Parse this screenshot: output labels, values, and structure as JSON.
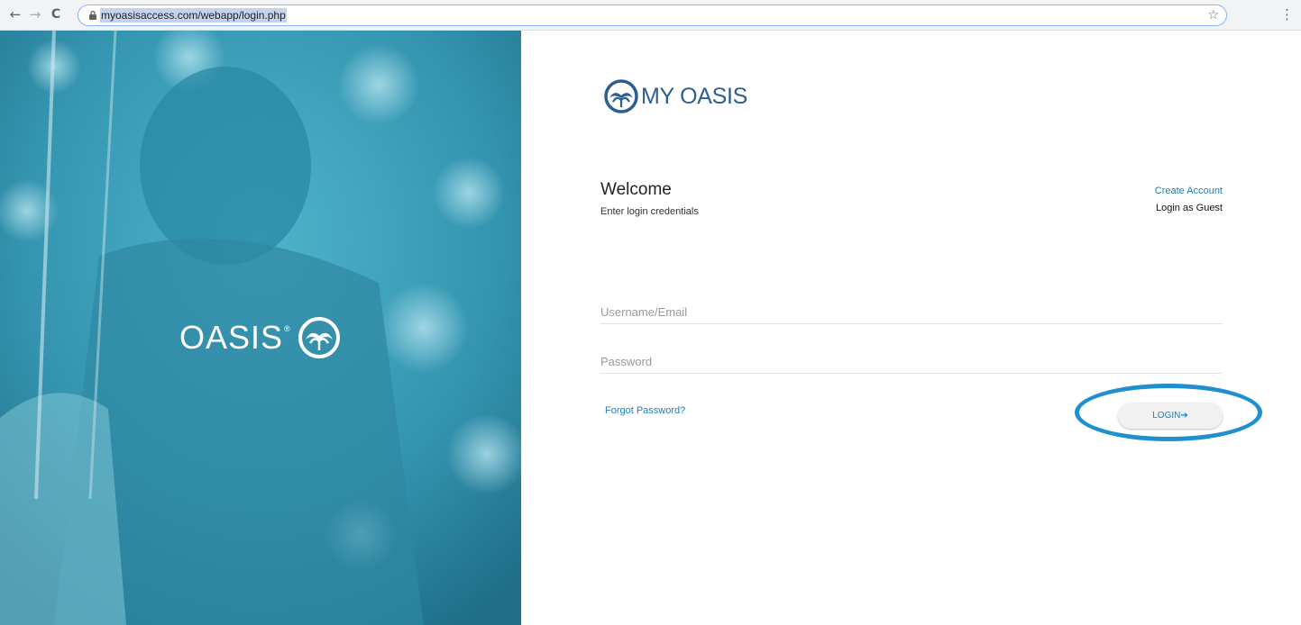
{
  "browser": {
    "back_icon": "arrow-left-icon",
    "forward_icon": "arrow-right-icon",
    "reload_icon": "reload-icon",
    "url": "myoasisaccess.com/webapp/login.php",
    "back_glyph": "←",
    "forward_glyph": "→",
    "reload_glyph": "C",
    "star_glyph": "☆",
    "menu_glyph": "⋮"
  },
  "hero": {
    "brand_word": "OASIS",
    "registered_mark": "®"
  },
  "brand": {
    "name": "MY OASIS"
  },
  "welcome": {
    "title": "Welcome",
    "subtitle": "Enter login credentials"
  },
  "links": {
    "create_account": "Create Account",
    "guest_login": "Login as Guest",
    "forgot_password": "Forgot Password?"
  },
  "form": {
    "username_placeholder": "Username/Email",
    "password_placeholder": "Password",
    "username_value": "",
    "password_value": "",
    "login_label": "LOGIN➔"
  },
  "colors": {
    "brand_blue": "#2e5e8e",
    "link_blue": "#1a7fc1",
    "hero_teal": "#3fa7bf",
    "highlight_ring": "#1f8fd0"
  }
}
